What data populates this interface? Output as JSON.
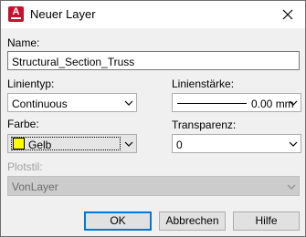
{
  "window": {
    "title": "Neuer Layer"
  },
  "name": {
    "label": "Name:",
    "value": "Structural_Section_Truss"
  },
  "linetype": {
    "label": "Linientyp:",
    "value": "Continuous"
  },
  "lineweight": {
    "label": "Linienstärke:",
    "value": "0.00 mm"
  },
  "color": {
    "label": "Farbe:",
    "value": "Gelb",
    "swatch_color": "#ffff00"
  },
  "transparency": {
    "label": "Transparenz:",
    "value": "0"
  },
  "plotstyle": {
    "label": "Plotstil:",
    "value": "VonLayer"
  },
  "buttons": {
    "ok": "OK",
    "cancel": "Abbrechen",
    "help": "Hilfe"
  },
  "accent_color": "#0078d7",
  "icons": {
    "app": "autocad-app-icon",
    "close": "close-icon",
    "dropdown": "chevron-down-icon"
  }
}
